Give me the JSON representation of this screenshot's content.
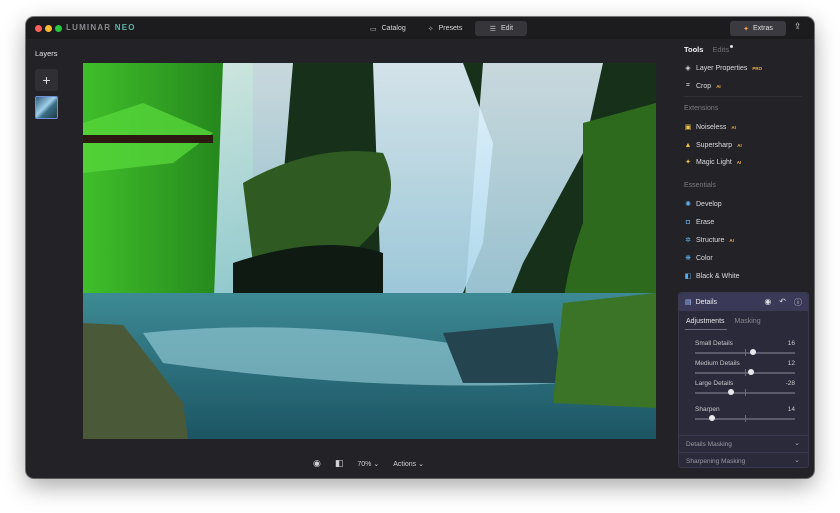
{
  "app": {
    "brand_main": "LUMINAR",
    "brand_sub": "NEO"
  },
  "top_nav": {
    "catalog": "Catalog",
    "presets": "Presets",
    "edit": "Edit",
    "extras": "Extras"
  },
  "layers": {
    "title": "Layers",
    "add": "+"
  },
  "bottom_bar": {
    "zoom": "70%",
    "actions": "Actions"
  },
  "panel": {
    "tab_tools": "Tools",
    "tab_edits": "Edits",
    "top_tools": [
      {
        "label": "Layer Properties",
        "badge": "PRO",
        "icon": "layers-icon"
      },
      {
        "label": "Crop",
        "badge": "AI",
        "icon": "crop-icon"
      }
    ],
    "extensions_label": "Extensions",
    "extensions": [
      {
        "label": "Noiseless",
        "badge": "AI",
        "icon": "noiseless-icon"
      },
      {
        "label": "Supersharp",
        "badge": "AI",
        "icon": "supersharp-icon"
      },
      {
        "label": "Magic Light",
        "badge": "AI",
        "icon": "magic-light-icon"
      }
    ],
    "essentials_label": "Essentials",
    "essentials": [
      {
        "label": "Develop",
        "badge": "",
        "icon": "develop-icon"
      },
      {
        "label": "Erase",
        "badge": "",
        "icon": "erase-icon"
      },
      {
        "label": "Structure",
        "badge": "AI",
        "icon": "structure-icon"
      },
      {
        "label": "Color",
        "badge": "",
        "icon": "color-icon"
      },
      {
        "label": "Black & White",
        "badge": "",
        "icon": "black-white-icon"
      }
    ],
    "details": {
      "title": "Details",
      "tab_adjustments": "Adjustments",
      "tab_masking": "Masking",
      "sliders": [
        {
          "label": "Small Details",
          "value": "16",
          "fraction": 0.58
        },
        {
          "label": "Medium Details",
          "value": "12",
          "fraction": 0.56
        },
        {
          "label": "Large Details",
          "value": "-28",
          "fraction": 0.36
        },
        {
          "label": "Sharpen",
          "value": "14",
          "fraction": 0.17
        }
      ],
      "details_masking": "Details Masking",
      "sharpening_masking": "Sharpening Masking"
    }
  },
  "colors": {
    "accent": "#f2a45a",
    "brand_neo": "#5bb3a8",
    "details_head": "#3a3958"
  }
}
